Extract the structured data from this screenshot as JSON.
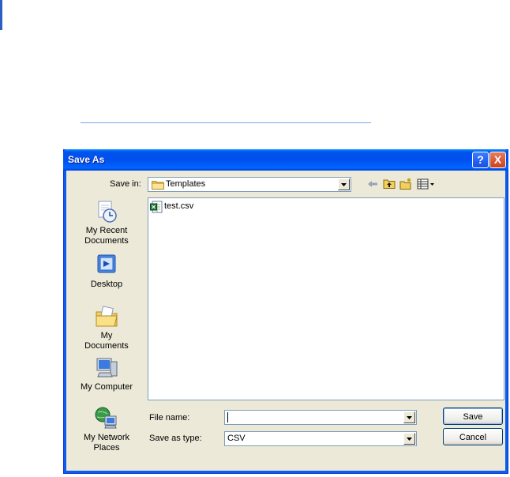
{
  "dialog": {
    "title": "Save As",
    "help_glyph": "?",
    "close_glyph": "X"
  },
  "toolbar": {
    "save_in_label": "Save in:",
    "save_in_value": "Templates",
    "icons": [
      "back-arrow-icon",
      "up-one-level-icon",
      "new-folder-icon",
      "view-menu-icon"
    ]
  },
  "places": [
    {
      "label": "My Recent Documents",
      "icon": "recent-documents-icon"
    },
    {
      "label": "Desktop",
      "icon": "desktop-icon"
    },
    {
      "label": "My Documents",
      "icon": "my-documents-icon"
    },
    {
      "label": "My Computer",
      "icon": "my-computer-icon"
    },
    {
      "label": "My Network Places",
      "icon": "network-places-icon"
    }
  ],
  "files": [
    {
      "name": "test.csv",
      "icon": "excel-csv-icon"
    }
  ],
  "form": {
    "file_name_label": "File name:",
    "file_name_value": "",
    "save_as_type_label": "Save as type:",
    "save_as_type_value": "CSV"
  },
  "buttons": {
    "save": "Save",
    "cancel": "Cancel"
  },
  "colors": {
    "titlebar": "#0053ee",
    "dialog_bg": "#ece9d8",
    "close": "#c9421f"
  }
}
